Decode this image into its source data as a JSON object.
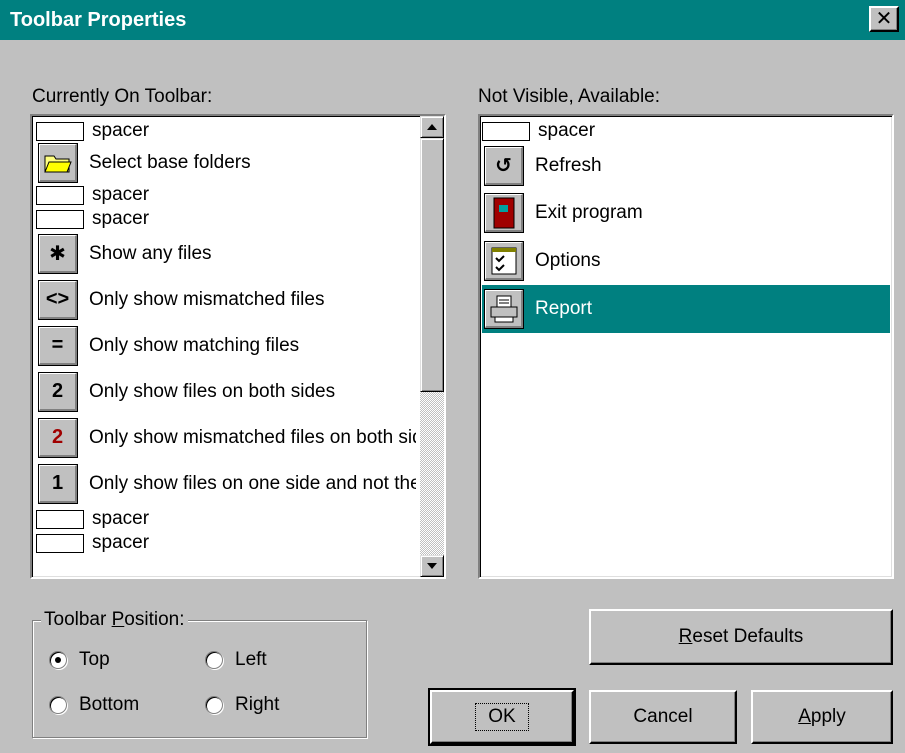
{
  "window": {
    "title": "Toolbar Properties",
    "close_glyph": "✕"
  },
  "left_list": {
    "label": "Currently On Toolbar:",
    "items": [
      {
        "kind": "spacer",
        "label": "spacer"
      },
      {
        "kind": "icon",
        "icon": "folder-icon",
        "label": "Select base folders"
      },
      {
        "kind": "spacer",
        "label": "spacer"
      },
      {
        "kind": "spacer",
        "label": "spacer"
      },
      {
        "kind": "icon",
        "icon": "asterisk-icon",
        "glyph": "✱",
        "label": "Show any files"
      },
      {
        "kind": "icon",
        "icon": "mismatch-icon",
        "glyph": "<>",
        "label": "Only show mismatched files"
      },
      {
        "kind": "icon",
        "icon": "equals-icon",
        "glyph": "=",
        "label": "Only show matching files"
      },
      {
        "kind": "icon",
        "icon": "two-icon",
        "glyph": "2",
        "label": "Only show files on both sides"
      },
      {
        "kind": "icon",
        "icon": "two-red-icon",
        "glyph": "2",
        "color": "#a00000",
        "label": "Only show mismatched files on both sides"
      },
      {
        "kind": "icon",
        "icon": "one-icon",
        "glyph": "1",
        "label": "Only show files on one side and not the other"
      },
      {
        "kind": "spacer",
        "label": "spacer"
      },
      {
        "kind": "spacer",
        "label": "spacer"
      }
    ]
  },
  "right_list": {
    "label": "Not Visible, Available:",
    "selected_index": 4,
    "items": [
      {
        "kind": "spacer",
        "label": "spacer"
      },
      {
        "kind": "icon",
        "icon": "refresh-icon",
        "glyph": "↺",
        "label": "Refresh"
      },
      {
        "kind": "icon",
        "icon": "exit-door-icon",
        "label": "Exit program"
      },
      {
        "kind": "icon",
        "icon": "options-icon",
        "label": "Options"
      },
      {
        "kind": "icon",
        "icon": "printer-icon",
        "label": "Report"
      }
    ]
  },
  "position_group": {
    "legend_pre": "Toolbar ",
    "legend_ul": "P",
    "legend_post": "osition:",
    "selected": "Top",
    "options": {
      "top": "Top",
      "left": "Left",
      "bottom": "Bottom",
      "right": "Right"
    }
  },
  "buttons": {
    "reset_ul": "R",
    "reset_rest": "eset Defaults",
    "ok": "OK",
    "cancel": "Cancel",
    "apply_ul": "A",
    "apply_rest": "pply"
  },
  "colors": {
    "titlebar": "#008080",
    "selection": "#008080",
    "face": "#c0c0c0"
  }
}
